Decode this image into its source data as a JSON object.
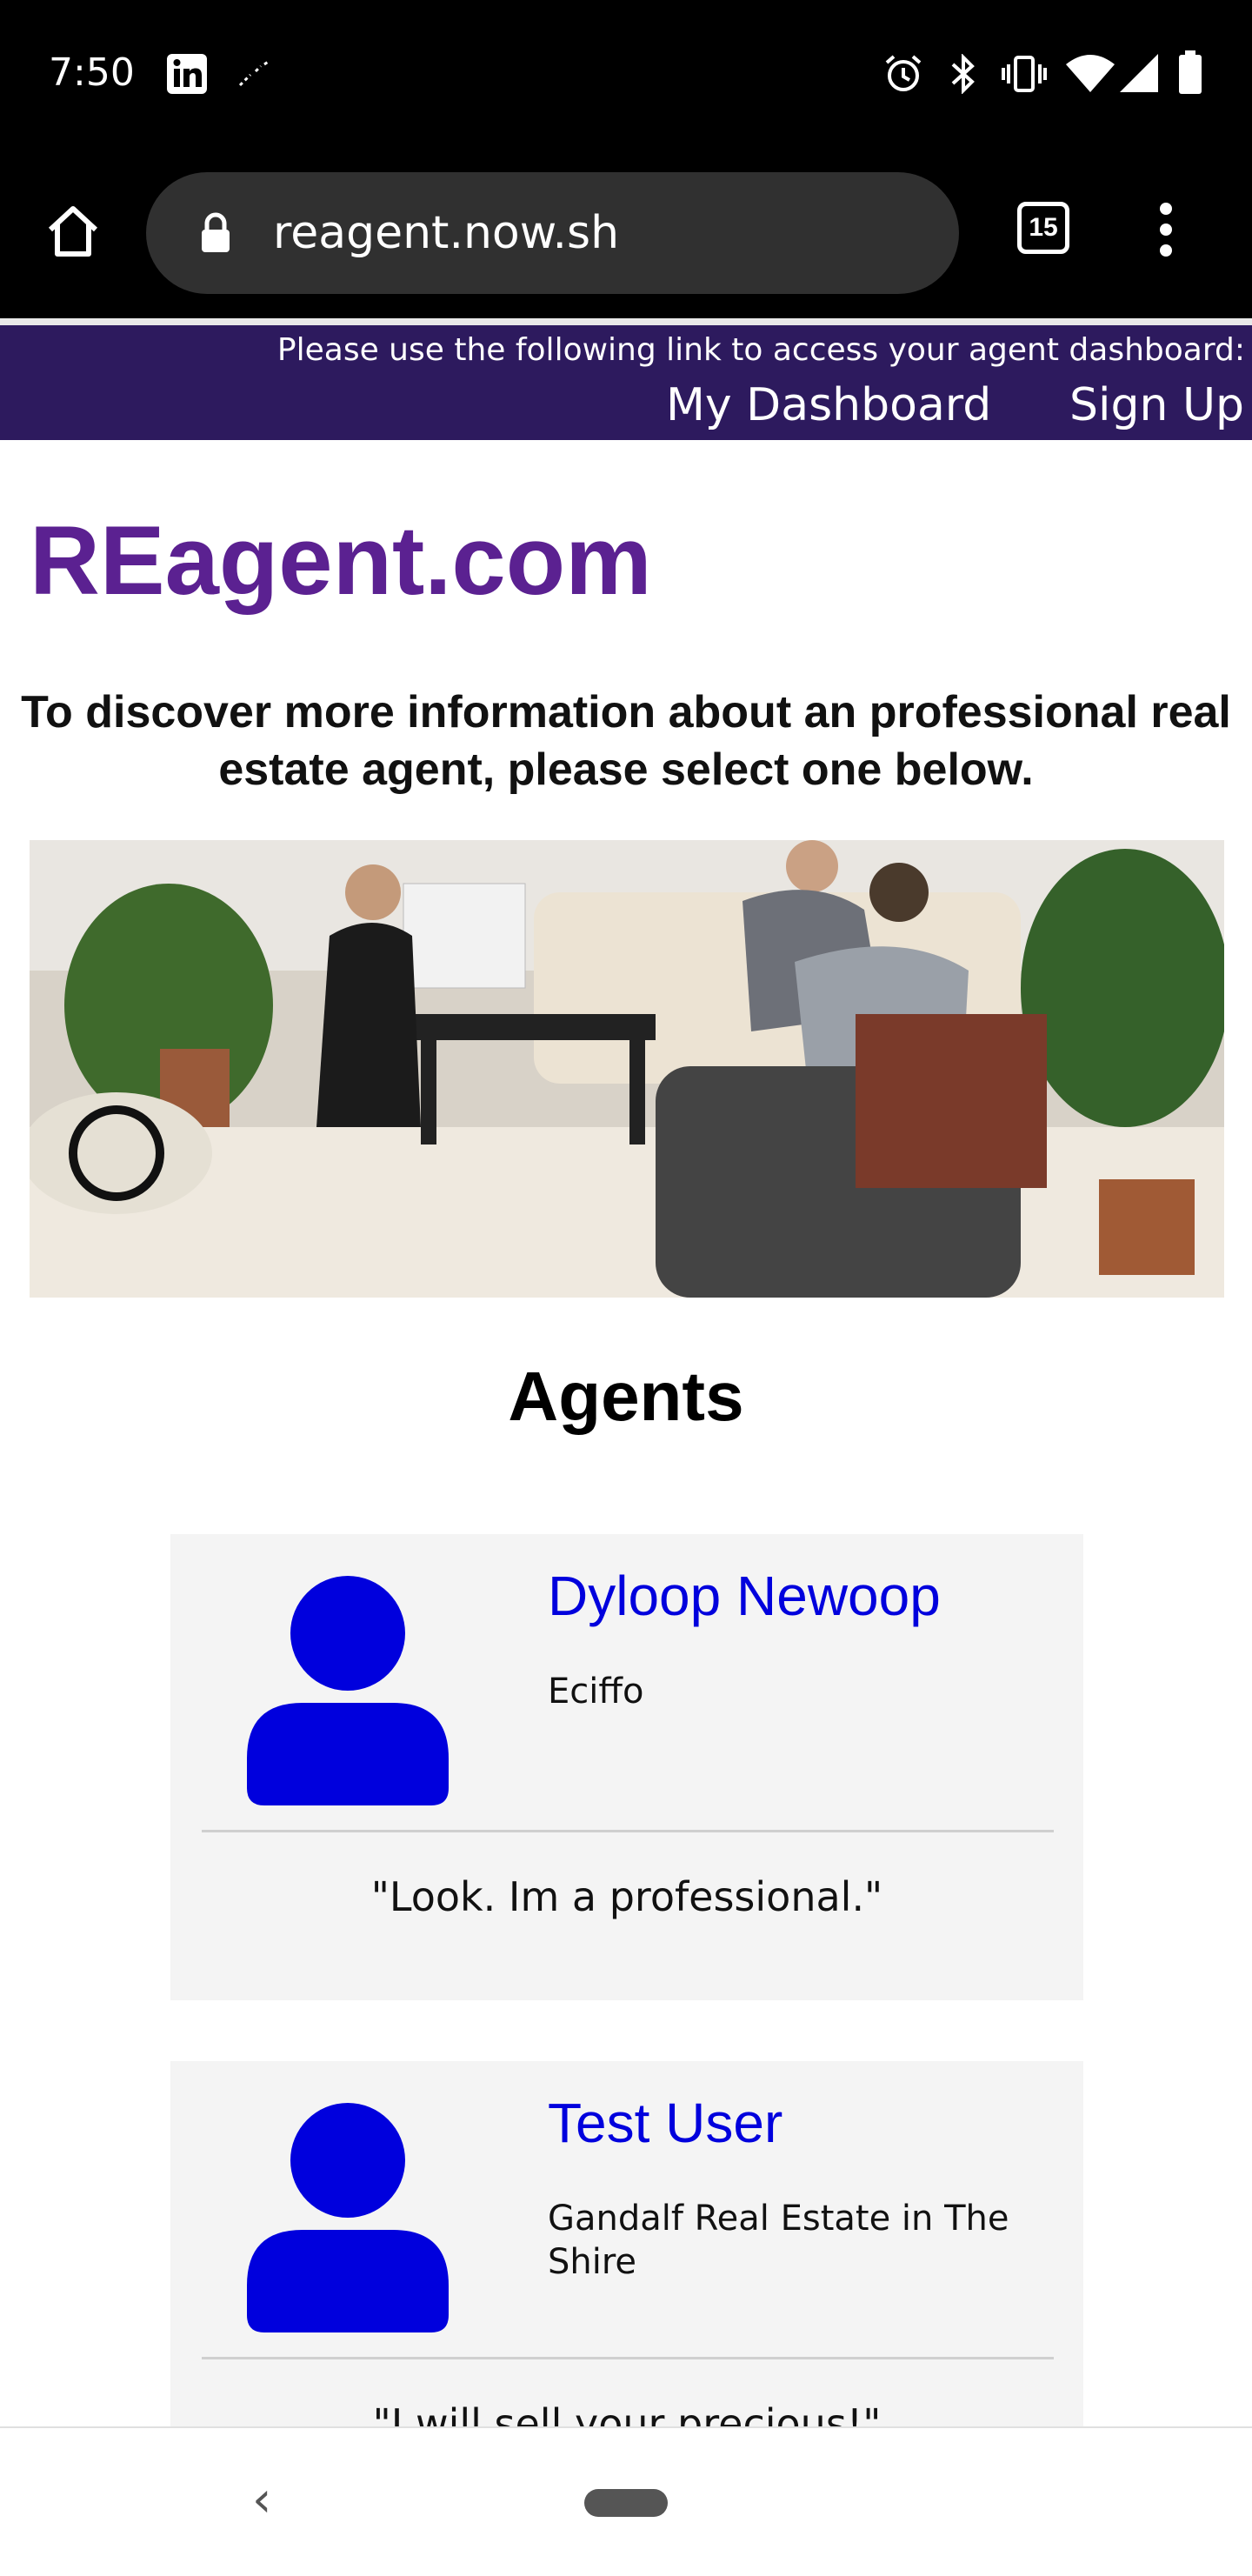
{
  "status_bar": {
    "time": "7:50",
    "icons": [
      "linkedin-icon",
      "sparkle-icon",
      "alarm-icon",
      "bluetooth-icon",
      "vibrate-icon",
      "wifi-icon",
      "signal-icon",
      "battery-icon"
    ]
  },
  "browser": {
    "url": "reagent.now.sh",
    "tab_count": "15",
    "icons": [
      "home-icon",
      "lock-icon",
      "tabs-icon",
      "more-vert-icon"
    ]
  },
  "top_nav": {
    "notice": "Please use the following link to access your agent dashboard:",
    "dashboard_link": "My Dashboard",
    "signup_link": "Sign Up",
    "bg_color": "#2d1a5e"
  },
  "site": {
    "brand": "REagent.com",
    "brand_color": "#5b2191",
    "intro": "To discover more information about an professional real estate agent, please select one below."
  },
  "agents_heading": "Agents",
  "agents": [
    {
      "name": "Dyloop Newoop",
      "company": "Eciffo",
      "quote": "\"Look. Im a professional.\""
    },
    {
      "name": "Test User",
      "company": "Gandalf Real Estate in The Shire",
      "quote": "\"I will sell your precious!\""
    }
  ],
  "accent_color": "#0000dd"
}
